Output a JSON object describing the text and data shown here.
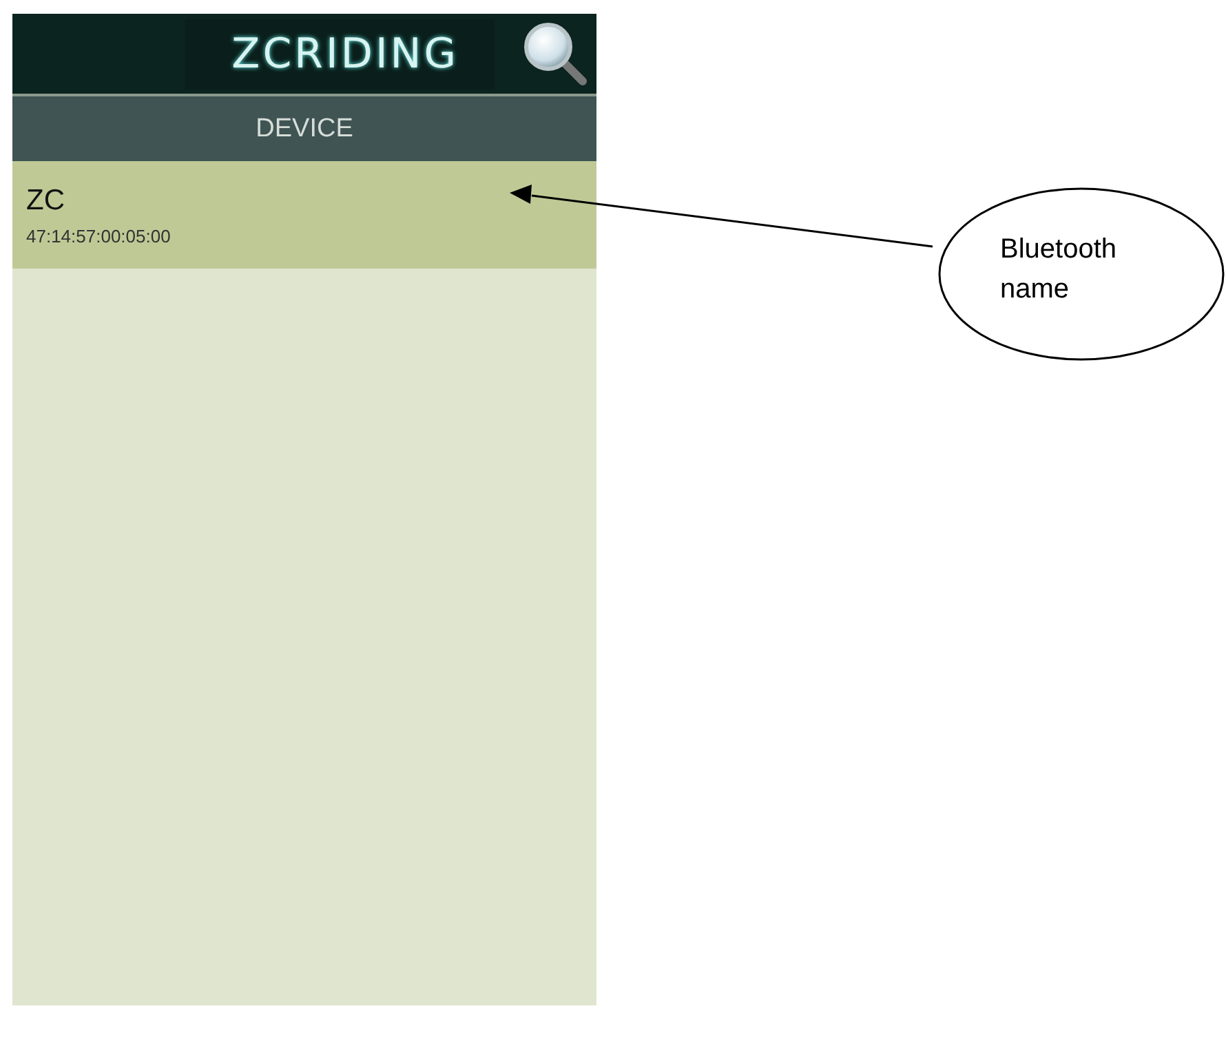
{
  "app_bar": {
    "title": "ZCRIDING"
  },
  "section": {
    "title": "DEVICE"
  },
  "devices": [
    {
      "name": "ZC",
      "address": "47:14:57:00:05:00",
      "selected": true
    }
  ],
  "callout": {
    "lines": [
      "Bluetooth",
      "name"
    ]
  }
}
